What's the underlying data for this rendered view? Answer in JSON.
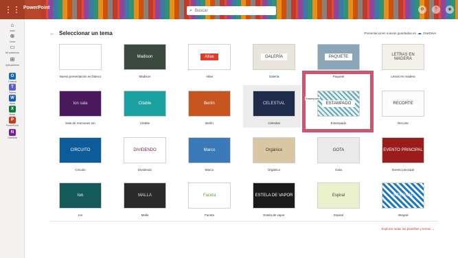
{
  "app": {
    "name": "PowerPoint",
    "search_placeholder": "Buscar"
  },
  "rail": [
    {
      "id": "home",
      "icon": "⌂",
      "label": "Inicio"
    },
    {
      "id": "create",
      "icon": "⊕",
      "label": "Crear"
    },
    {
      "id": "files",
      "icon": "▭",
      "label": "Mi contenido"
    },
    {
      "id": "apps",
      "icon": "⊞",
      "label": "Aplicaciones"
    },
    {
      "id": "outlook",
      "icon": "O",
      "label": "Outlook",
      "color": "#0f6cbd"
    },
    {
      "id": "teams",
      "icon": "T",
      "label": "Teams",
      "color": "#5b5fc7"
    },
    {
      "id": "word",
      "icon": "W",
      "label": "Word",
      "color": "#185abd"
    },
    {
      "id": "excel",
      "icon": "X",
      "label": "Excel",
      "color": "#107c41"
    },
    {
      "id": "powerpoint",
      "icon": "P",
      "label": "PowerPoint",
      "color": "#c43e1c"
    },
    {
      "id": "onenote",
      "icon": "N",
      "label": "OneNote",
      "color": "#7719aa"
    }
  ],
  "header": {
    "back_icon": "←",
    "title": "Seleccionar un tema",
    "saved_text": "Presentaciones nuevas guardadas en",
    "onedrive": "OneDrive"
  },
  "themes": [
    {
      "id": "blank",
      "label": "Nueva presentación en blanco",
      "thumb_text": "",
      "bg": "#ffffff",
      "fg": "#000"
    },
    {
      "id": "madison",
      "label": "Madison",
      "thumb_text": "Madison",
      "bg": "#3a4a3f",
      "fg": "#fff"
    },
    {
      "id": "atlas",
      "label": "Atlas",
      "thumb_text": "Atlas",
      "bg": "#ffffff",
      "fg": "#fff"
    },
    {
      "id": "galeria",
      "label": "Galería",
      "thumb_text": "GALERÍA",
      "bg": "#e9e5dc",
      "fg": "#333"
    },
    {
      "id": "paquete",
      "label": "Paquete",
      "thumb_text": "PAQUETE",
      "bg": "#8aa5b8",
      "fg": "#333"
    },
    {
      "id": "madera",
      "label": "Letras en madera",
      "thumb_text": "LETRAS EN MADERA",
      "bg": "#f4f1ea",
      "fg": "#444"
    },
    {
      "id": "ion-sala",
      "label": "Sala de reuniones Ion",
      "thumb_text": "Ion sala",
      "bg": "#4a1a5c",
      "fg": "#ddd"
    },
    {
      "id": "citable",
      "label": "Citable",
      "thumb_text": "Citable",
      "bg": "#1ba1a0",
      "fg": "#fff"
    },
    {
      "id": "berlin",
      "label": "Berlín",
      "thumb_text": "Berlín",
      "bg": "#c6551f",
      "fg": "#fff"
    },
    {
      "id": "celestial",
      "label": "Celestial",
      "thumb_text": "CELESTIAL",
      "bg": "#1e2b4a",
      "fg": "#cfd8ff"
    },
    {
      "id": "estampado",
      "label": "Estampado",
      "thumb_text": "ESTAMPADO",
      "bg": "#e8f0f2",
      "fg": "#333"
    },
    {
      "id": "recorte",
      "label": "Recorte",
      "thumb_text": "RECORTE",
      "bg": "#fbfbfb",
      "fg": "#333"
    },
    {
      "id": "circuito",
      "label": "Circuito",
      "thumb_text": "CIRCUITO",
      "bg": "#0c5c9a",
      "fg": "#fff"
    },
    {
      "id": "dividendo",
      "label": "Dividendo",
      "thumb_text": "DIVIDENDO",
      "bg": "#ffffff",
      "fg": "#6b1a3a"
    },
    {
      "id": "marco",
      "label": "Marco",
      "thumb_text": "Marco",
      "bg": "#3a7ab8",
      "fg": "#fff"
    },
    {
      "id": "organico",
      "label": "Orgánico",
      "thumb_text": "Orgánico",
      "bg": "#d9c7a3",
      "fg": "#333"
    },
    {
      "id": "gota",
      "label": "Gota",
      "thumb_text": "GOTA",
      "bg": "#eaeaea",
      "fg": "#333"
    },
    {
      "id": "evento",
      "label": "Evento principal",
      "thumb_text": "EVENTO PRINCIPAL",
      "bg": "#9a1c1c",
      "fg": "#fff"
    },
    {
      "id": "ion",
      "label": "Ion",
      "thumb_text": "Ion",
      "bg": "#155a5a",
      "fg": "#fff"
    },
    {
      "id": "malla",
      "label": "Malla",
      "thumb_text": "MALLA",
      "bg": "#2a2a2a",
      "fg": "#ddd"
    },
    {
      "id": "faceta",
      "label": "Faceta",
      "thumb_text": "Faceta",
      "bg": "#ffffff",
      "fg": "#5aa02c"
    },
    {
      "id": "estela",
      "label": "Estela de vapor",
      "thumb_text": "ESTELA DE VAPOR",
      "bg": "#1a1a1a",
      "fg": "#fff"
    },
    {
      "id": "espiral",
      "label": "Espiral",
      "thumb_text": "Espiral",
      "bg": "#e9f1cc",
      "fg": "#444"
    },
    {
      "id": "integral",
      "label": "Integral",
      "thumb_text": "INTEGRAL",
      "bg": "#1f78c4",
      "fg": "#fff"
    }
  ],
  "explore_link": "Explorar todas las plantillas y temas →",
  "tooltip": "Estampado"
}
